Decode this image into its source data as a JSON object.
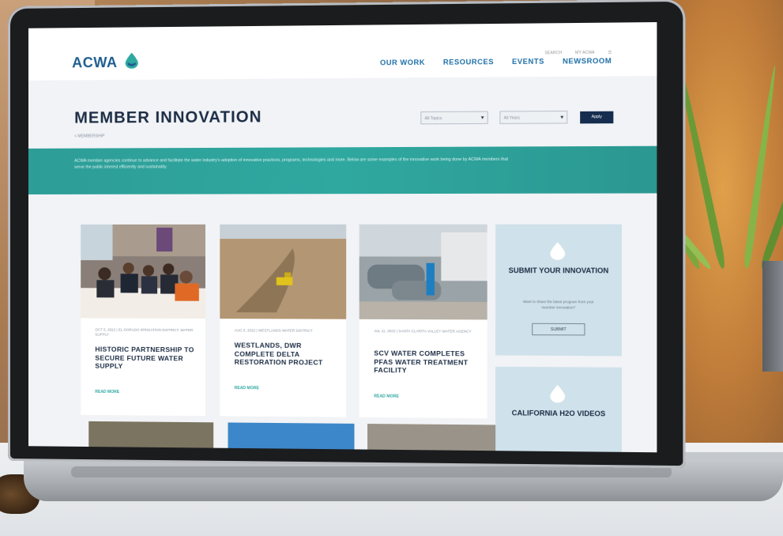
{
  "site": {
    "logo_text": "ACWA",
    "utility_links": [
      "SEARCH",
      "MY ACWA",
      "☰"
    ],
    "nav": [
      "OUR WORK",
      "RESOURCES",
      "EVENTS",
      "NEWSROOM"
    ]
  },
  "page": {
    "title": "MEMBER INNOVATION",
    "breadcrumb": "< MEMBERSHIP",
    "filters": [
      {
        "placeholder": "All Topics",
        "chevron": "▾"
      },
      {
        "placeholder": "All Years",
        "chevron": "▾"
      }
    ],
    "apply_label": "Apply",
    "banner_text": "ACWA member agencies continue to advance and facilitate the water industry's adoption of innovative practices, programs, technologies and more. Below are some examples of the innovative work being done by ACWA members that serve the public interest efficiently and sustainably."
  },
  "cards": [
    {
      "meta": "OCT 5, 2022 | EL DORADO IRRIGATION DISTRICT, WATER SUPPLY",
      "headline": "HISTORIC PARTNERSHIP TO SECURE FUTURE WATER SUPPLY",
      "cta": "READ MORE"
    },
    {
      "meta": "AUG 5, 2022 | WESTLANDS WATER DISTRICT",
      "headline": "WESTLANDS, DWR COMPLETE DELTA RESTORATION PROJECT",
      "cta": "READ MORE"
    },
    {
      "meta": "JUL 11, 2022 | SANTA CLARITA VALLEY WATER AGENCY",
      "headline": "SCV WATER COMPLETES PFAS WATER TREATMENT FACILITY",
      "cta": "READ MORE"
    }
  ],
  "sidebar": [
    {
      "title": "SUBMIT YOUR INNOVATION",
      "desc": "Want to share the latest program from your member innovation?",
      "button": "SUBMIT"
    },
    {
      "title": "CALIFORNIA H2O VIDEOS"
    }
  ],
  "colors": {
    "accent_teal": "#2fa8a0",
    "navy": "#1c2d45",
    "brand_blue": "#1e6fa8"
  }
}
